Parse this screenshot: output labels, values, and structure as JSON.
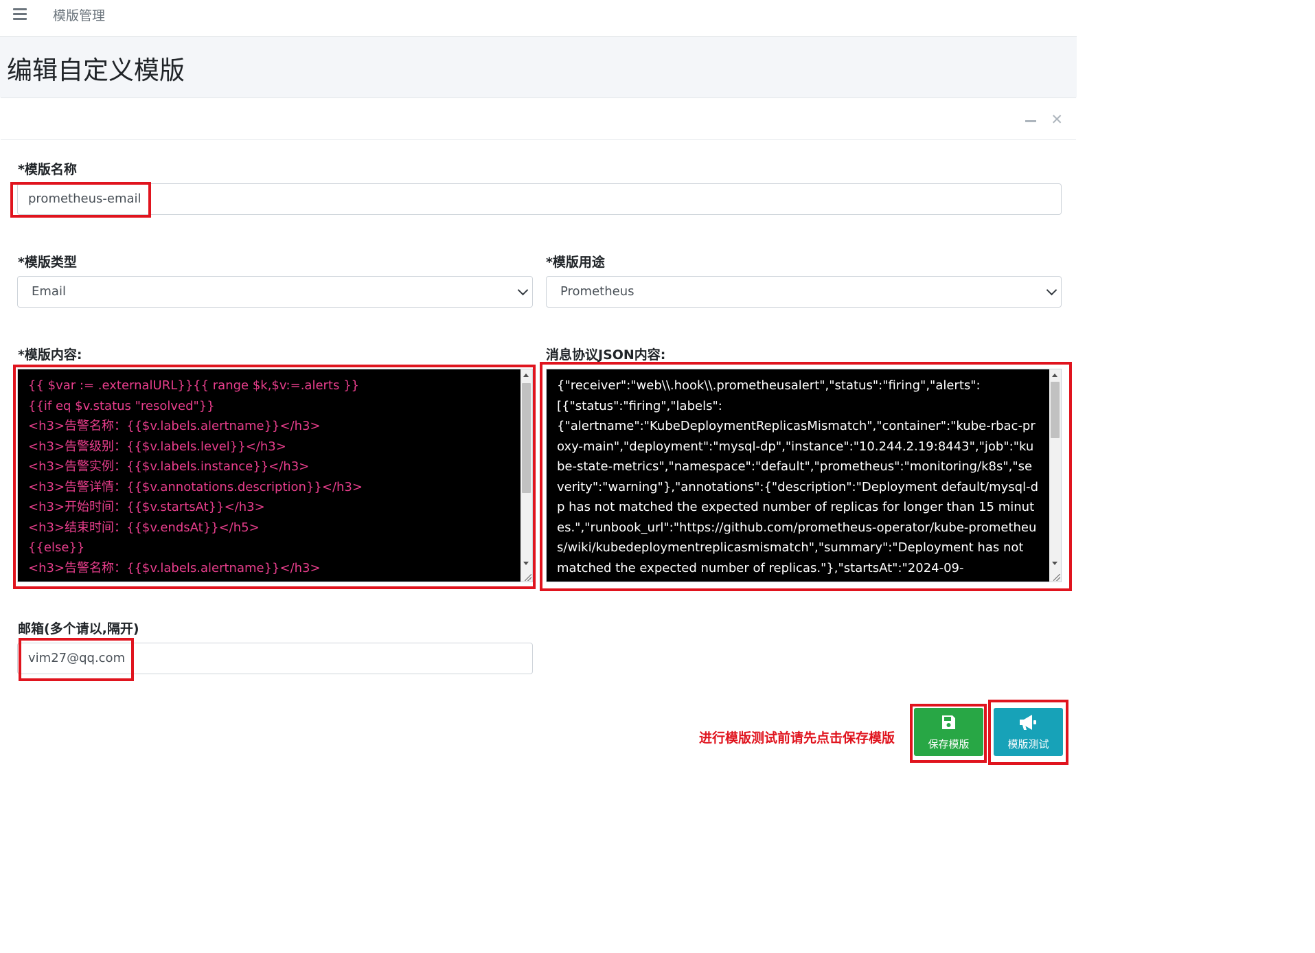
{
  "topbar": {
    "breadcrumb": "模版管理"
  },
  "page": {
    "title": "编辑自定义模版"
  },
  "form": {
    "name": {
      "label": "*模版名称",
      "value": "prometheus-email"
    },
    "type": {
      "label": "*模版类型",
      "value": "Email"
    },
    "usage": {
      "label": "*模版用途",
      "value": "Prometheus"
    },
    "content": {
      "label": "*模版内容:",
      "value": "{{ $var := .externalURL}}{{ range $k,$v:=.alerts }}\n{{if eq $v.status \"resolved\"}}\n<h3>告警名称：{{$v.labels.alertname}}</h3>\n<h3>告警级别：{{$v.labels.level}}</h3>\n<h3>告警实例：{{$v.labels.instance}}</h3>\n<h3>告警详情：{{$v.annotations.description}}</h3>\n<h3>开始时间：{{$v.startsAt}}</h3>\n<h3>结束时间：{{$v.endsAt}}</h5>\n{{else}}\n<h3>告警名称：{{$v.labels.alertname}}</h3>"
    },
    "json": {
      "label": "消息协议JSON内容:",
      "value": "{\"receiver\":\"web\\\\.hook\\\\.prometheusalert\",\"status\":\"firing\",\"alerts\":\n[{\"status\":\"firing\",\"labels\":\n{\"alertname\":\"KubeDeploymentReplicasMismatch\",\"container\":\"kube-rbac-proxy-main\",\"deployment\":\"mysql-dp\",\"instance\":\"10.244.2.19:8443\",\"job\":\"kube-state-metrics\",\"namespace\":\"default\",\"prometheus\":\"monitoring/k8s\",\"severity\":\"warning\"},\"annotations\":{\"description\":\"Deployment default/mysql-dp has not matched the expected number of replicas for longer than 15 minutes.\",\"runbook_url\":\"https://github.com/prometheus-operator/kube-prometheus/wiki/kubedeploymentreplicasmismatch\",\"summary\":\"Deployment has not matched the expected number of replicas.\"},\"startsAt\":\"2024-09-"
    },
    "email": {
      "label": "邮箱(多个请以,隔开)",
      "value": "vim27@qq.com"
    }
  },
  "notice": "进行模版测试前请先点击保存模版",
  "buttons": {
    "save": "保存模版",
    "test": "模版测试"
  },
  "colors": {
    "highlight": "#e0141e",
    "save": "#28a745",
    "test": "#17a2b8",
    "template_text": "#e83e8c"
  }
}
